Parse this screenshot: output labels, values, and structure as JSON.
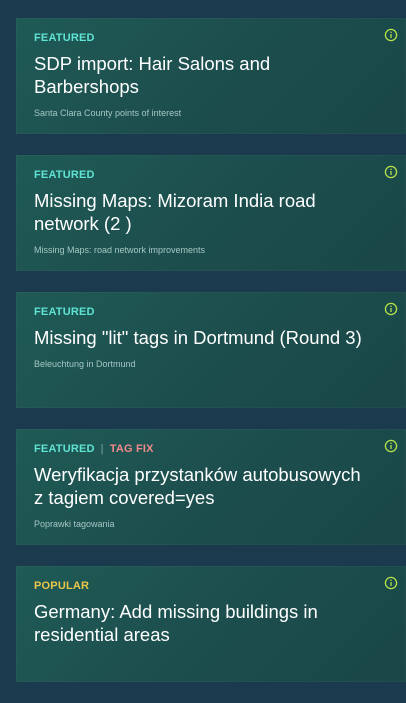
{
  "cards": [
    {
      "tags": [
        "FEATURED"
      ],
      "title": "SDP import: Hair Salons and Barbershops",
      "subtitle": "Santa Clara County points of interest"
    },
    {
      "tags": [
        "FEATURED"
      ],
      "title": "Missing Maps: Mizoram India road network (2 )",
      "subtitle": "Missing Maps: road network improvements"
    },
    {
      "tags": [
        "FEATURED"
      ],
      "title": "Missing \"lit\" tags in Dortmund (Round 3)",
      "subtitle": "Beleuchtung in Dortmund"
    },
    {
      "tags": [
        "FEATURED",
        "TAG FIX"
      ],
      "title": "Weryfikacja przystanków autobusowych z tagiem covered=yes",
      "subtitle": "Poprawki tagowania"
    },
    {
      "tags": [
        "POPULAR"
      ],
      "title": "Germany: Add missing buildings in residential areas",
      "subtitle": ""
    }
  ],
  "icons": {
    "info": "info-circle-icon"
  },
  "colors": {
    "featured": "#5fe3d4",
    "popular": "#e9c54b",
    "tag_fix": "#f08a8a",
    "info_icon": "#b5e24a"
  }
}
